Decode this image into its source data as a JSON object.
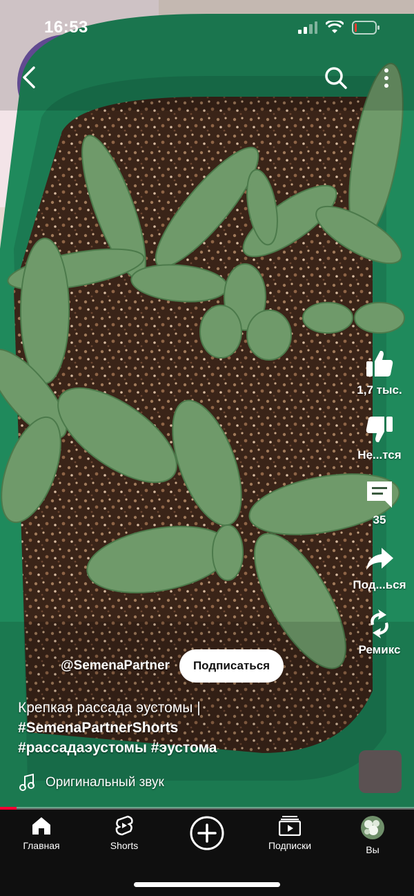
{
  "status_bar": {
    "time": "16:53"
  },
  "video": {
    "channel_handle": "@SemenaPartner",
    "subscribe_label": "Подписаться",
    "caption_text": "Крепкая рассада эустомы | ",
    "caption_tags": [
      "#SemenaPartnerShorts",
      "#рассадаэустомы",
      "#эустома"
    ],
    "sound_label": "Оригинальный звук",
    "progress_fraction": 0.04
  },
  "actions": {
    "like_count": "1,7 тыс.",
    "dislike_label": "Не...тся",
    "comments_count": "35",
    "share_label": "Под...ься",
    "remix_label": "Ремикс"
  },
  "bottom_nav": {
    "home": "Главная",
    "shorts": "Shorts",
    "subscriptions": "Подписки",
    "you": "Вы"
  },
  "icons": [
    "back-icon",
    "search-icon",
    "more-icon",
    "like-icon",
    "dislike-icon",
    "comment-icon",
    "share-icon",
    "remix-icon",
    "music-note-icon",
    "home-icon",
    "shorts-icon",
    "create-icon",
    "subscriptions-icon",
    "avatar"
  ],
  "colors": {
    "accent": "#ff0033",
    "nav_bg": "#0f0f0f",
    "tray_green": "#1f8a5c"
  }
}
